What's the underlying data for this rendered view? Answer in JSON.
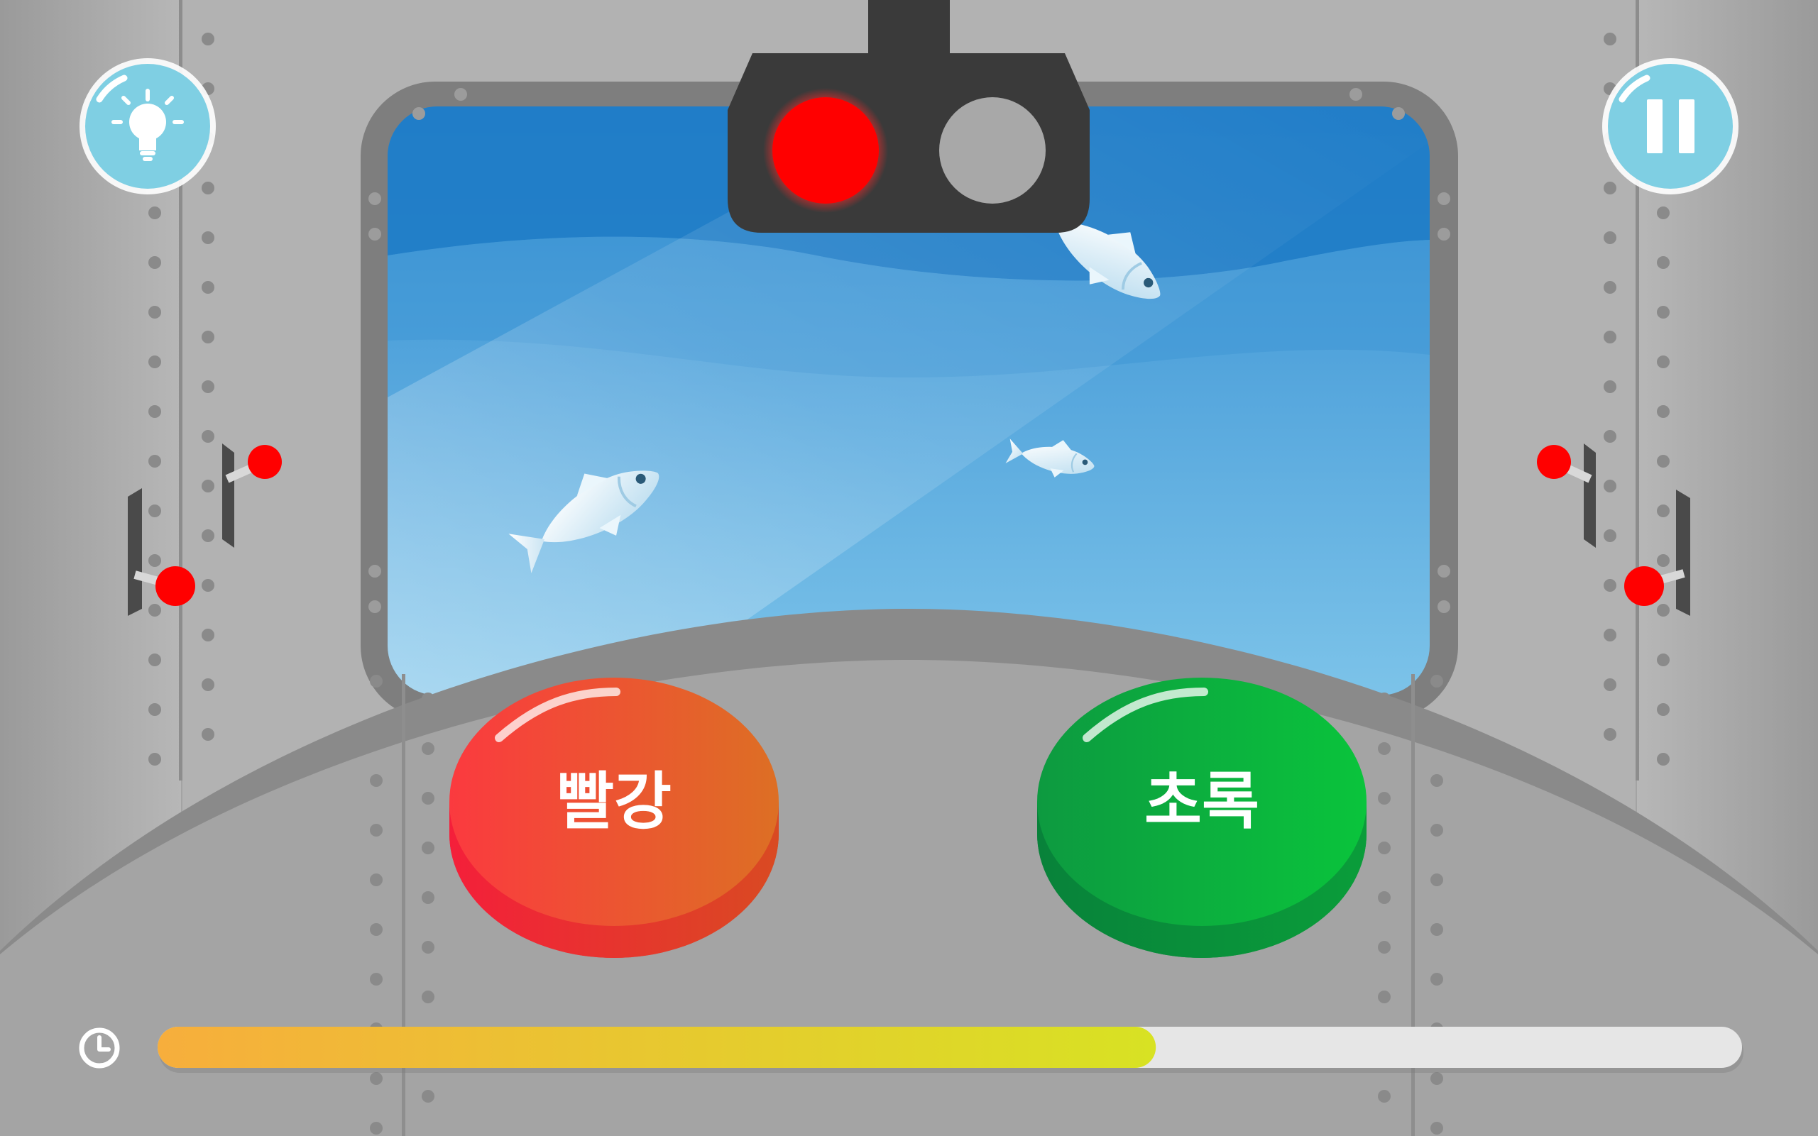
{
  "game": {
    "hint_button": {
      "icon": "lightbulb-icon"
    },
    "pause_button": {
      "icon": "pause-icon"
    },
    "signal_light": {
      "left_lamp": {
        "state": "on",
        "color": "#ff0000"
      },
      "right_lamp": {
        "state": "off",
        "color": "#a8a8a8"
      }
    },
    "answer_buttons": [
      {
        "label": "빨강",
        "color": "#f0412f"
      },
      {
        "label": "초록",
        "color": "#0bb53e"
      }
    ],
    "timer": {
      "icon": "clock-icon",
      "progress": 0.63,
      "colors": {
        "start": "#f7ae3c",
        "end": "#d8e223",
        "track": "#e6e6e6"
      }
    },
    "window_scene": {
      "fish": [
        "fish-top-right",
        "fish-middle-small",
        "fish-lower-left"
      ]
    }
  }
}
